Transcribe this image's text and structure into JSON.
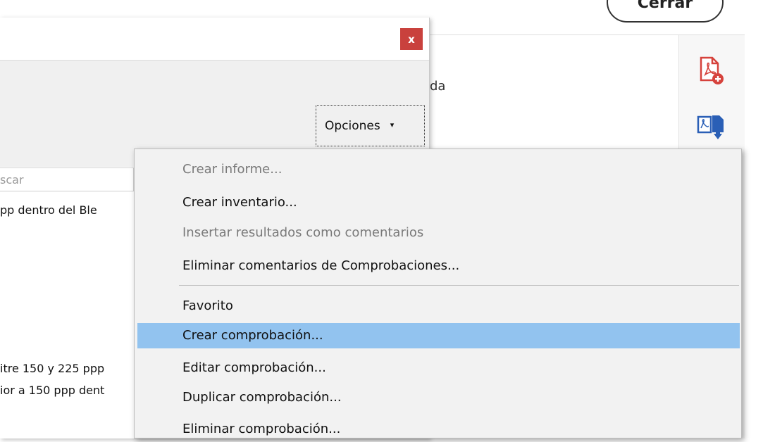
{
  "background": {
    "close_button_label": "Cerrar",
    "partial_text": "da"
  },
  "right_panel": {
    "icons": [
      "create-pdf-icon",
      "export-pdf-icon"
    ]
  },
  "dialog": {
    "close_label": "x",
    "options_button": {
      "label": "Opciones",
      "arrow": "▾"
    },
    "search": {
      "placeholder": "scar"
    },
    "list_lines": [
      "pp dentro del Ble",
      "itre 150 y 225 ppp",
      "ior a 150 ppp dent"
    ]
  },
  "menu": {
    "items": [
      {
        "label": "Crear informe...",
        "state": "disabled"
      },
      {
        "label": "Crear inventario...",
        "state": "enabled"
      },
      {
        "label": "Insertar resultados como comentarios",
        "state": "disabled"
      },
      {
        "label": "Eliminar comentarios de Comprobaciones...",
        "state": "enabled"
      },
      {
        "label": "Favorito",
        "state": "enabled"
      },
      {
        "label": "Crear comprobación...",
        "state": "highlighted"
      },
      {
        "label": "Editar comprobación...",
        "state": "enabled"
      },
      {
        "label": "Duplicar comprobación...",
        "state": "enabled"
      },
      {
        "label": "Eliminar comprobación...",
        "state": "enabled"
      }
    ]
  },
  "colors": {
    "highlight": "#92c3ef",
    "close_red": "#c9413d",
    "pdf_red": "#d6423c",
    "export_blue": "#2a5fb6"
  }
}
